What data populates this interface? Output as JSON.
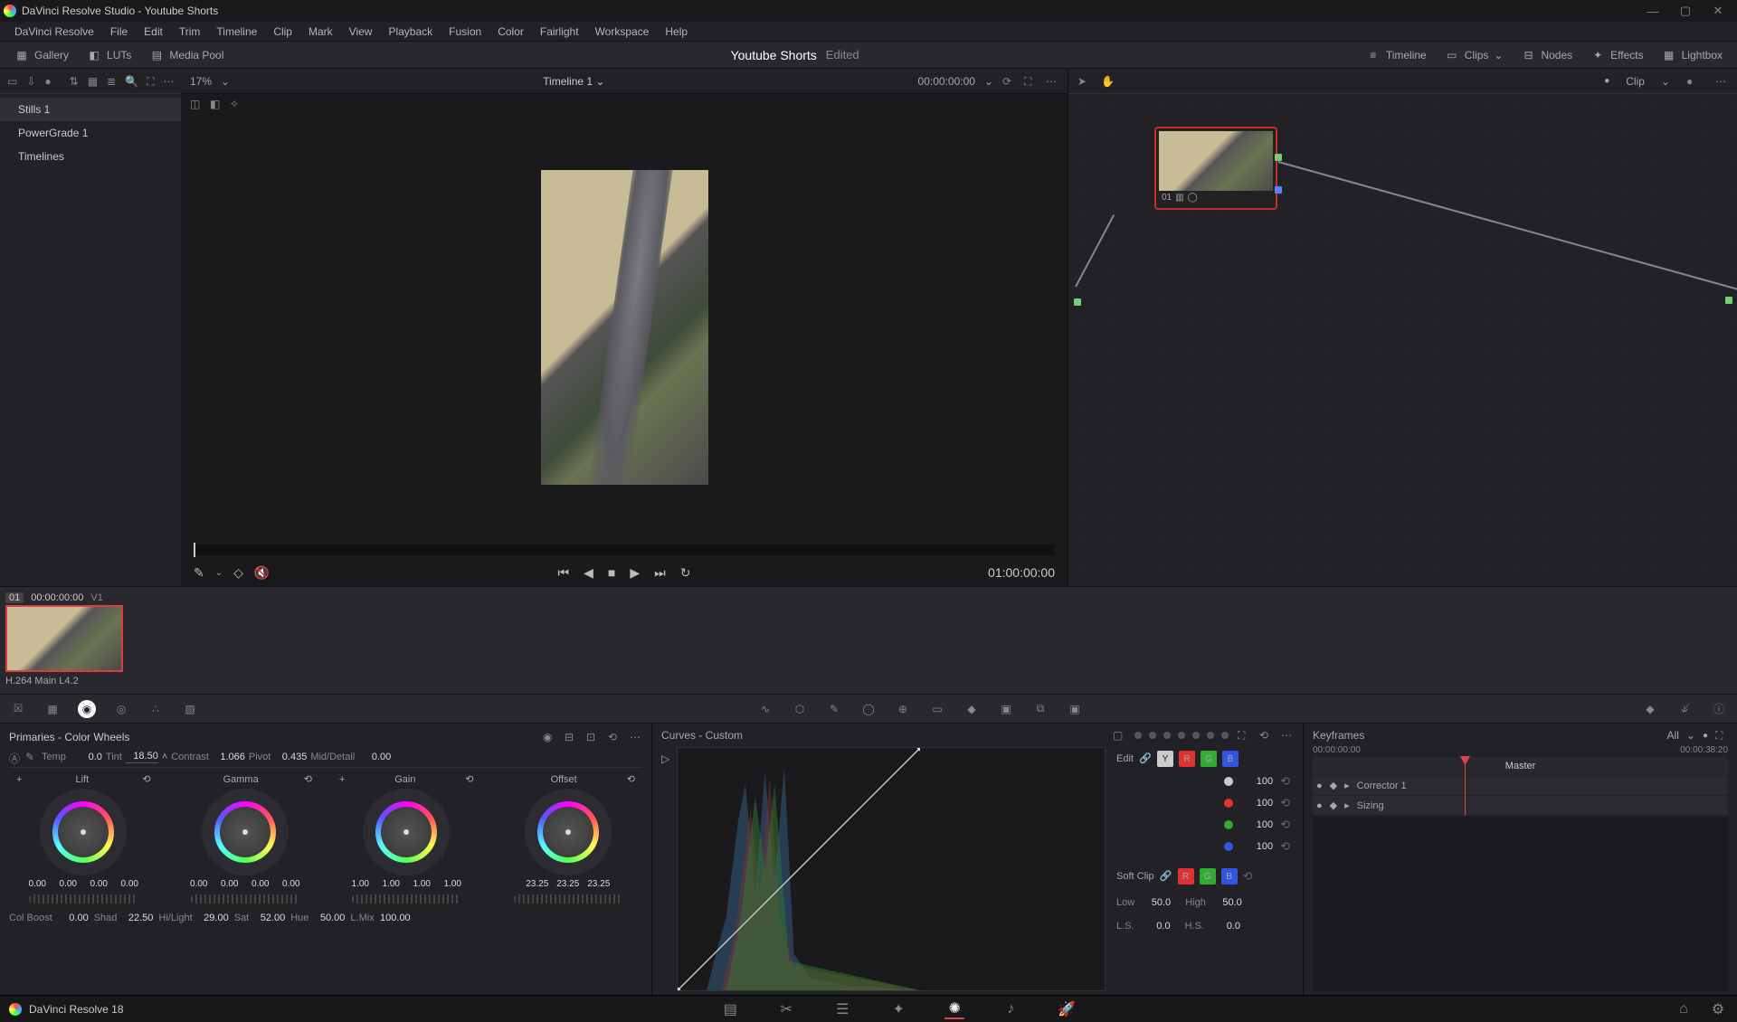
{
  "window": {
    "title": "DaVinci Resolve Studio - Youtube Shorts"
  },
  "menu": [
    "DaVinci Resolve",
    "File",
    "Edit",
    "Trim",
    "Timeline",
    "Clip",
    "Mark",
    "View",
    "Playback",
    "Fusion",
    "Color",
    "Fairlight",
    "Workspace",
    "Help"
  ],
  "topbar": {
    "gallery": "Gallery",
    "luts": "LUTs",
    "mediapool": "Media Pool",
    "project": "Youtube Shorts",
    "status": "Edited",
    "timeline": "Timeline",
    "clips": "Clips",
    "nodes": "Nodes",
    "effects": "Effects",
    "lightbox": "Lightbox"
  },
  "stills": {
    "items": [
      "Stills 1",
      "PowerGrade 1",
      "Timelines"
    ],
    "active": 0
  },
  "viewer": {
    "zoom": "17%",
    "timeline_name": "Timeline 1",
    "tc_head": "00:00:00:00",
    "tc_big": "01:00:00:00"
  },
  "nodes": {
    "right_label": "Clip",
    "node_id": "01"
  },
  "clip": {
    "num": "01",
    "tc": "00:00:00:00",
    "track": "V1",
    "codec": "H.264 Main L4.2"
  },
  "primaries": {
    "title": "Primaries - Color Wheels",
    "row1": {
      "temp_l": "Temp",
      "temp": "0.0",
      "tint_l": "Tint",
      "tint": "18.50",
      "contrast_l": "Contrast",
      "contrast": "1.066",
      "pivot_l": "Pivot",
      "pivot": "0.435",
      "md_l": "Mid/Detail",
      "md": "0.00"
    },
    "wheels": [
      {
        "name": "Lift",
        "vals": [
          "0.00",
          "0.00",
          "0.00",
          "0.00"
        ]
      },
      {
        "name": "Gamma",
        "vals": [
          "0.00",
          "0.00",
          "0.00",
          "0.00"
        ]
      },
      {
        "name": "Gain",
        "vals": [
          "1.00",
          "1.00",
          "1.00",
          "1.00"
        ]
      },
      {
        "name": "Offset",
        "vals": [
          "23.25",
          "23.25",
          "23.25"
        ]
      }
    ],
    "row2": {
      "cb_l": "Col Boost",
      "cb": "0.00",
      "shad_l": "Shad",
      "shad": "22.50",
      "hl_l": "Hi/Light",
      "hl": "29.00",
      "sat_l": "Sat",
      "sat": "52.00",
      "hue_l": "Hue",
      "hue": "50.00",
      "lm_l": "L.Mix",
      "lm": "100.00"
    }
  },
  "curves": {
    "title": "Curves - Custom",
    "edit": "Edit",
    "softclip": "Soft Clip",
    "intensities": [
      "100",
      "100",
      "100",
      "100"
    ],
    "low_l": "Low",
    "low": "50.0",
    "high_l": "High",
    "high": "50.0",
    "ls_l": "L.S.",
    "ls": "0.0",
    "hs_l": "H.S.",
    "hs": "0.0"
  },
  "keyframes": {
    "title": "Keyframes",
    "all": "All",
    "tc_start": "00:00:00:00",
    "tc_end": "00:00:38:20",
    "master": "Master",
    "rows": [
      "Corrector 1",
      "Sizing"
    ]
  },
  "footer": {
    "app": "DaVinci Resolve 18"
  }
}
